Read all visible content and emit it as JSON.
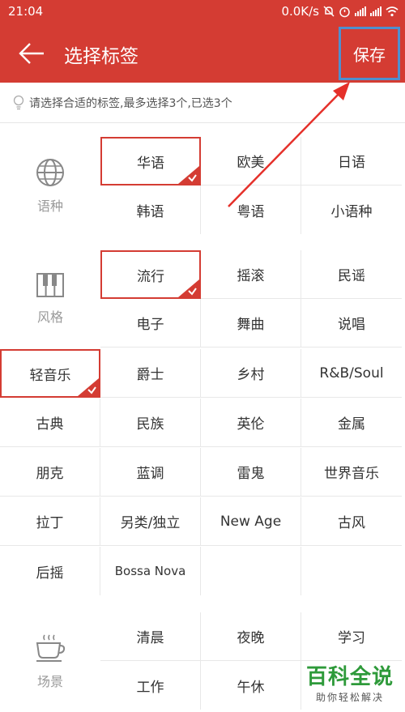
{
  "status": {
    "time": "21:04",
    "speed": "0.0K/s"
  },
  "header": {
    "title": "选择标签",
    "save_label": "保存"
  },
  "hint": "请选择合适的标签,最多选择3个,已选3个",
  "categories": {
    "language": {
      "label": "语种",
      "tags": [
        "华语",
        "欧美",
        "日语",
        "韩语",
        "粤语",
        "小语种"
      ]
    },
    "style": {
      "label": "风格",
      "tags": [
        "流行",
        "摇滚",
        "民谣",
        "电子",
        "舞曲",
        "说唱",
        "轻音乐",
        "爵士",
        "乡村",
        "R&B/Soul",
        "古典",
        "民族",
        "英伦",
        "金属",
        "朋克",
        "蓝调",
        "雷鬼",
        "世界音乐",
        "拉丁",
        "另类/独立",
        "New Age",
        "古风",
        "后摇",
        "Bossa Nova"
      ]
    },
    "scene": {
      "label": "场景",
      "tags": [
        "清晨",
        "夜晚",
        "学习",
        "工作",
        "午休"
      ]
    }
  },
  "selected": [
    "华语",
    "流行",
    "轻音乐"
  ],
  "watermark": {
    "main": "百科全说",
    "sub": "助你轻松解决"
  },
  "colors": {
    "accent": "#d43c33",
    "highlight": "#4f8fcf",
    "watermark": "#2e9a3a"
  }
}
